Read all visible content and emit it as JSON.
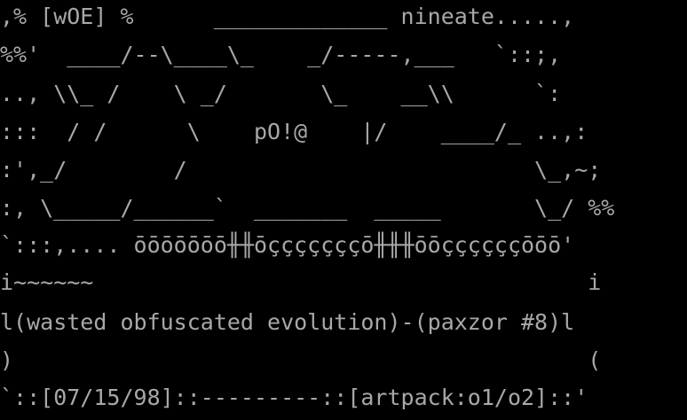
{
  "colors": {
    "background": "#000000",
    "text": "#a8a8a8"
  },
  "art": {
    "lines": [
      ",% [wOE] %      _____________ nineate.....,",
      "%%'  ____/--\\____\\_    _/-----,___   `::;,",
      ".., \\\\_ /    \\ _/       \\_    __\\\\      `:",
      ":::  / /      \\    pO!@    |/    ____/_ ..,:",
      ":',_/        /                          \\_,~;",
      ":, \\_____/______`  _______  _____       \\_/ %%",
      "`:::,.... ōōōōōōō╫╫ōçççççççō╫╫╫ōōççççççōōō'",
      "i~~~~~~                                     i",
      "l(wasted obfuscated evolution)-(paxzor #8)l",
      ")                                           (",
      "`::[07/15/98]::---------::[artpack:o1/o2]::'"
    ]
  }
}
